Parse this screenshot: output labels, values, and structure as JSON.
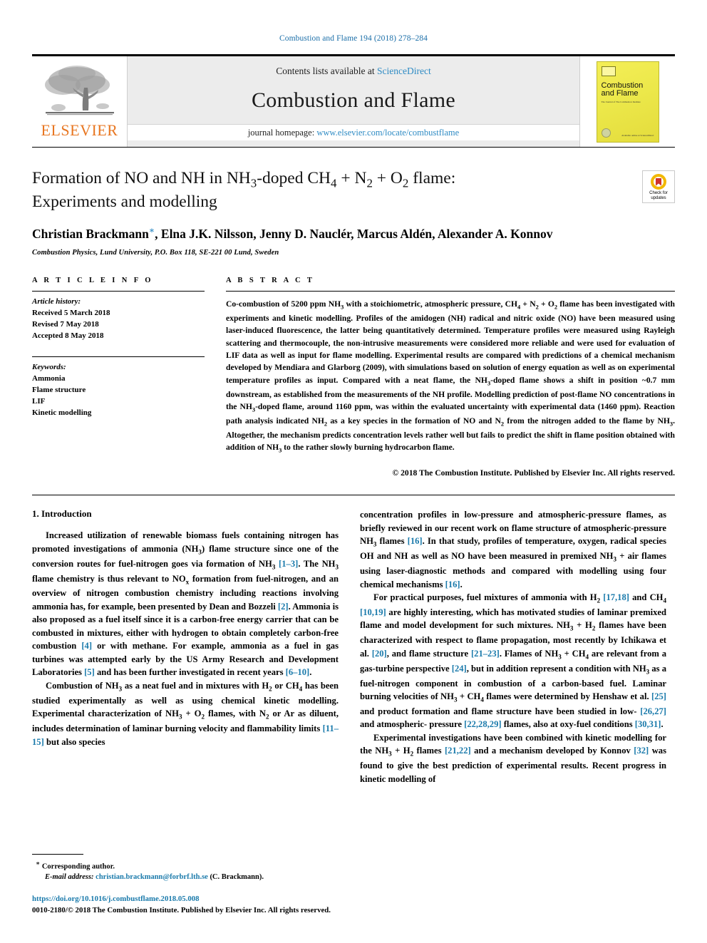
{
  "running_head": "Combustion and Flame 194 (2018) 278–284",
  "masthead": {
    "publisher_wordmark": "ELSEVIER",
    "contents_prefix": "Contents lists available at ",
    "contents_link": "ScienceDirect",
    "journal_name": "Combustion and Flame",
    "homepage_prefix": "journal homepage: ",
    "homepage_url": "www.elsevier.com/locate/combustflame",
    "cover": {
      "title_line1": "Combustion",
      "title_line2": "and Flame",
      "subtitle": "The Journal of The Combustion Institute",
      "bottom_note": "Available online at\nScienceDirect"
    },
    "colors": {
      "link": "#2e8bc4",
      "elsevier_orange": "#E87722",
      "panel_gray": "#ececec"
    }
  },
  "article": {
    "title_line1_html": "Formation of NO and NH in NH<sub>3</sub>-doped CH<sub>4</sub> + N<sub>2</sub> + O<sub>2</sub> flame:",
    "title_line2": "Experiments and modelling",
    "authors_html": "Christian Brackmann<span class=\"star\">∗</span>, Elna J.K. Nilsson, Jenny D. Nauclér, Marcus Aldén, Alexander A. Konnov",
    "affiliation": "Combustion Physics, Lund University, P.O. Box 118, SE-221 00 Lund, Sweden",
    "crossmark_label_line1": "Check for",
    "crossmark_label_line2": "updates"
  },
  "article_info": {
    "heading": "A R T I C L E    I N F O",
    "history_label": "Article history:",
    "history": [
      "Received 5 March 2018",
      "Revised 7 May 2018",
      "Accepted 8 May 2018"
    ],
    "keywords_label": "Keywords:",
    "keywords": [
      "Ammonia",
      "Flame structure",
      "LIF",
      "Kinetic modelling"
    ]
  },
  "abstract": {
    "heading": "A B S T R A C T",
    "body_html": "Co-combustion of 5200 ppm NH<sub>3</sub> with a stoichiometric, atmospheric pressure, CH<sub>4</sub> + N<sub>2</sub> + O<sub>2</sub> flame has been investigated with experiments and kinetic modelling. Profiles of the amidogen (NH) radical and nitric oxide (NO) have been measured using laser-induced fluorescence, the latter being quantitatively determined. Temperature profiles were measured using Rayleigh scattering and thermocouple, the non-intrusive measurements were considered more reliable and were used for evaluation of LIF data as well as input for flame modelling. Experimental results are compared with predictions of a chemical mechanism developed by Mendiara and Glarborg (2009), with simulations based on solution of energy equation as well as on experimental temperature profiles as input. Compared with a neat flame, the NH<sub>3</sub>-doped flame shows a shift in position ~0.7 mm downstream, as established from the measurements of the NH profile. Modelling prediction of post-flame NO concentrations in the NH<sub>3</sub>-doped flame, around 1160 ppm, was within the evaluated uncertainty with experimental data (1460 ppm). Reaction path analysis indicated NH<sub>2</sub> as a key species in the formation of NO and N<sub>2</sub> from the nitrogen added to the flame by NH<sub>3</sub>. Altogether, the mechanism predicts concentration levels rather well but fails to predict the shift in flame position obtained with addition of NH<sub>3</sub> to the rather slowly burning hydrocarbon flame.",
    "copyright": "© 2018 The Combustion Institute. Published by Elsevier Inc. All rights reserved."
  },
  "body": {
    "section_heading": "1. Introduction",
    "left_paragraphs_html": [
      "Increased utilization of renewable biomass fuels containing nitrogen has promoted investigations of ammonia (NH<sub>3</sub>) flame structure since one of the conversion routes for fuel-nitrogen goes via formation of NH<sub>3</sub> <span class=\"ref\">[1–3]</span>. The NH<sub>3</sub> flame chemistry is thus relevant to NO<sub>x</sub> formation from fuel-nitrogen, and an overview of nitrogen combustion chemistry including reactions involving ammonia has, for example, been presented by Dean and Bozzeli <span class=\"ref\">[2]</span>. Ammonia is also proposed as a fuel itself since it is a carbon-free energy carrier that can be combusted in mixtures, either with hydrogen to obtain completely carbon-free combustion <span class=\"ref\">[4]</span> or with methane. For example, ammonia as a fuel in gas turbines was attempted early by the US Army Research and Development Laboratories <span class=\"ref\">[5]</span> and has been further investigated in recent years <span class=\"ref\">[6–10]</span>.",
      "Combustion of NH<sub>3</sub> as a neat fuel and in mixtures with H<sub>2</sub> or CH<sub>4</sub> has been studied experimentally as well as using chemical kinetic modelling. Experimental characterization of NH<sub>3</sub> + O<sub>2</sub> flames, with N<sub>2</sub> or Ar as diluent, includes determination of laminar burning velocity and flammability limits <span class=\"ref\">[11–15]</span> but also species"
    ],
    "right_paragraphs_html": [
      "concentration profiles in low-pressure and atmospheric-pressure flames, as briefly reviewed in our recent work on flame structure of atmospheric-pressure NH<sub>3</sub> flames <span class=\"ref\">[16]</span>. In that study, profiles of temperature, oxygen, radical species OH and NH as well as NO have been measured in premixed NH<sub>3</sub> + air flames using laser-diagnostic methods and compared with modelling using four chemical mechanisms <span class=\"ref\">[16]</span>.",
      "For practical purposes, fuel mixtures of ammonia with H<sub>2</sub> <span class=\"ref\">[17,18]</span> and CH<sub>4</sub> <span class=\"ref\">[10,19]</span> are highly interesting, which has motivated studies of laminar premixed flame and model development for such mixtures. NH<sub>3</sub> + H<sub>2</sub> flames have been characterized with respect to flame propagation, most recently by Ichikawa et al. <span class=\"ref\">[20]</span>, and flame structure <span class=\"ref\">[21–23]</span>. Flames of NH<sub>3</sub> + CH<sub>4</sub> are relevant from a gas-turbine perspective <span class=\"ref\">[24]</span>, but in addition represent a condition with NH<sub>3</sub> as a fuel-nitrogen component in combustion of a carbon-based fuel. Laminar burning velocities of NH<sub>3</sub> + CH<sub>4</sub> flames were determined by Henshaw et al. <span class=\"ref\">[25]</span> and product formation and flame structure have been studied in low- <span class=\"ref\">[26,27]</span> and atmospheric- pressure <span class=\"ref\">[22,28,29]</span> flames, also at oxy-fuel conditions <span class=\"ref\">[30,31]</span>.",
      "Experimental investigations have been combined with kinetic modelling for the NH<sub>3</sub> + H<sub>2</sub> flames <span class=\"ref\">[21,22]</span> and a mechanism developed by Konnov <span class=\"ref\">[32]</span> was found to give the best prediction of experimental results. Recent progress in kinetic modelling of"
    ]
  },
  "footnote": {
    "corresponding_marker": "∗",
    "corresponding_text": "Corresponding author.",
    "email_label": "E-mail address:",
    "email": "christian.brackmann@forbrf.lth.se",
    "email_owner": "(C. Brackmann).",
    "doi": "https://doi.org/10.1016/j.combustflame.2018.05.008",
    "issn_line": "0010-2180/© 2018 The Combustion Institute. Published by Elsevier Inc. All rights reserved."
  }
}
